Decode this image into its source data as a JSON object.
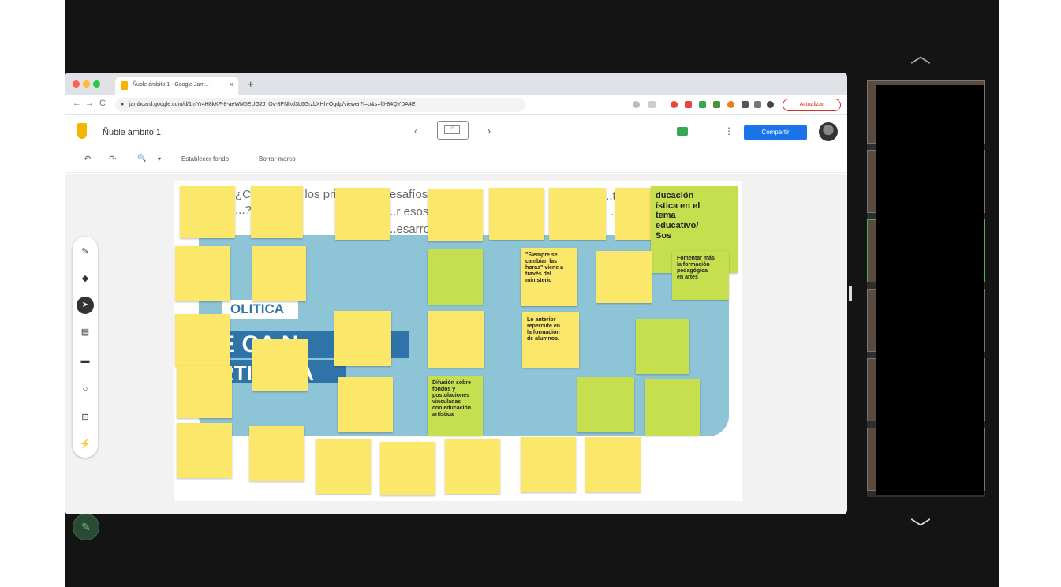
{
  "browser": {
    "tab_title": "Ñuble ámbito 1 - Google Jam...",
    "tab_close": "×",
    "new_tab": "+",
    "url": "jamboard.google.com/d/1mYr4H8kKF-8-aeWM5EUG2J_Ov-8PNlkd3L6GrzbXHh-Ogdp/viewer?f=o&s=f0-84QYDA4E",
    "update_label": "Actualizar",
    "nav_back": "←",
    "nav_forward": "→",
    "nav_reload": "C"
  },
  "app": {
    "board_title": "Ñuble ámbito 1",
    "frame_label": "1/1",
    "frame_prev": "‹",
    "frame_next": "›",
    "share_label": "Compartir",
    "more": "⋮"
  },
  "toolbar": {
    "undo": "↶",
    "redo": "↷",
    "zoom": "🔍",
    "zoom_caret": "▾",
    "set_background": "Establecer fondo",
    "clear_frame": "Borrar marco"
  },
  "board": {
    "bg_lines": [
      "¿Cuáles son los principales desafíos...",
      "...?       idem",
      "...r esos",
      "...esarro",
      "...te",
      "...di"
    ],
    "politica": "OLITICA",
    "banner_1": "E  CA    N",
    "banner_2": "RTISTICA",
    "big_notes": [
      "ducación\nística en el\ntema\neducativo/\nSos",
      "Fomentar más\nla formación\npedagógica\nen artes",
      "\"Siempre se\ncambian las\nhoras\" viene a\ntravés del\nministerio",
      "Lo anterior\nrepercute en\nla formación\nde alumnos.",
      "Difusión sobre\nfondos y\npostulaciones\nvinculadas\ncon educación\nartística"
    ]
  },
  "colors": {
    "note_yellow": "#fbe76a",
    "note_green": "#c5df4f",
    "board_blue": "#8ec5d6",
    "banner_blue": "#2f74a8",
    "share_blue": "#1a73e8",
    "update_red": "#d93025"
  },
  "icons": {
    "tool_pen": "pen-icon",
    "tool_eraser": "eraser-icon",
    "tool_select": "cursor-icon",
    "tool_sticky": "sticky-note-icon",
    "tool_image": "image-icon",
    "tool_circle": "shape-icon",
    "tool_textbox": "textbox-icon",
    "tool_laser": "laser-icon",
    "chevron_up": "chevron-up-icon",
    "chevron_down": "chevron-down-icon",
    "pen_floating": "pen-icon"
  },
  "tool_glyphs": {
    "pen": "✎",
    "eraser": "◆",
    "select": "➤",
    "sticky": "▤",
    "image": "▬",
    "circle": "○",
    "textbox": "⊡",
    "laser": "⚡"
  },
  "side": {
    "chevron_up": "︿",
    "chevron_down": "﹀",
    "pen_glyph": "✎"
  }
}
